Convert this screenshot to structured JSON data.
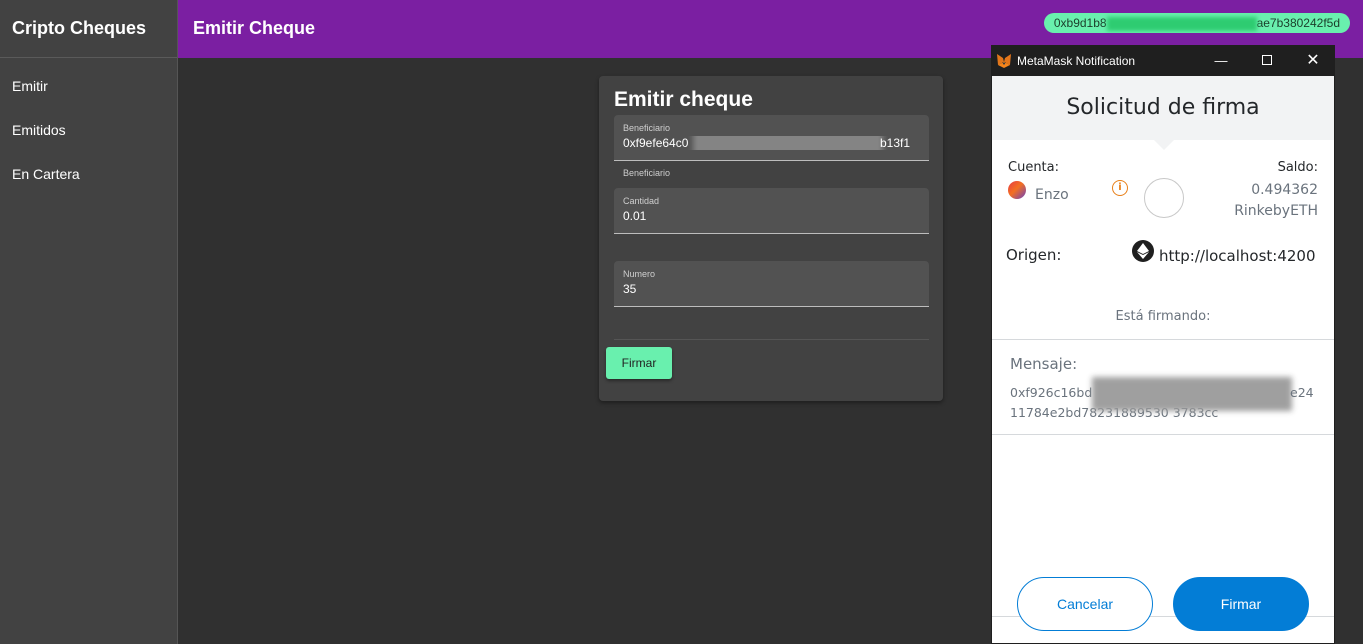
{
  "app": {
    "title": "Cripto Cheques",
    "page_title": "Emitir Cheque",
    "wallet_address_start": "0xb9d1b8",
    "wallet_address_end": "ae7b380242f5d"
  },
  "sidebar": {
    "items": [
      {
        "label": "Emitir"
      },
      {
        "label": "Emitidos"
      },
      {
        "label": "En Cartera"
      }
    ]
  },
  "form": {
    "title": "Emitir cheque",
    "beneficiario": {
      "label": "Beneficiario",
      "value_start": "0xf9efe64c0",
      "value_end": "b13f1",
      "hint": "Beneficiario"
    },
    "cantidad": {
      "label": "Cantidad",
      "value": "0.01"
    },
    "numero": {
      "label": "Numero",
      "value": "35"
    },
    "submit_label": "Firmar"
  },
  "metamask": {
    "window_title": "MetaMask Notification",
    "header": "Solicitud de firma",
    "cuenta_label": "Cuenta:",
    "saldo_label": "Saldo:",
    "account_name": "Enzo",
    "balance_value": "0.494362",
    "balance_unit": "RinkebyETH",
    "origen_label": "Origen:",
    "origin_url": "http://localhost:4200",
    "signing_label": "Está firmando:",
    "mensaje_label": "Mensaje:",
    "message_line1_start": "0xf926c16bd",
    "message_line1_end": "e24",
    "message_line2": "11784e2bd78231889530 3783cc",
    "cancel_label": "Cancelar",
    "sign_label": "Firmar"
  }
}
